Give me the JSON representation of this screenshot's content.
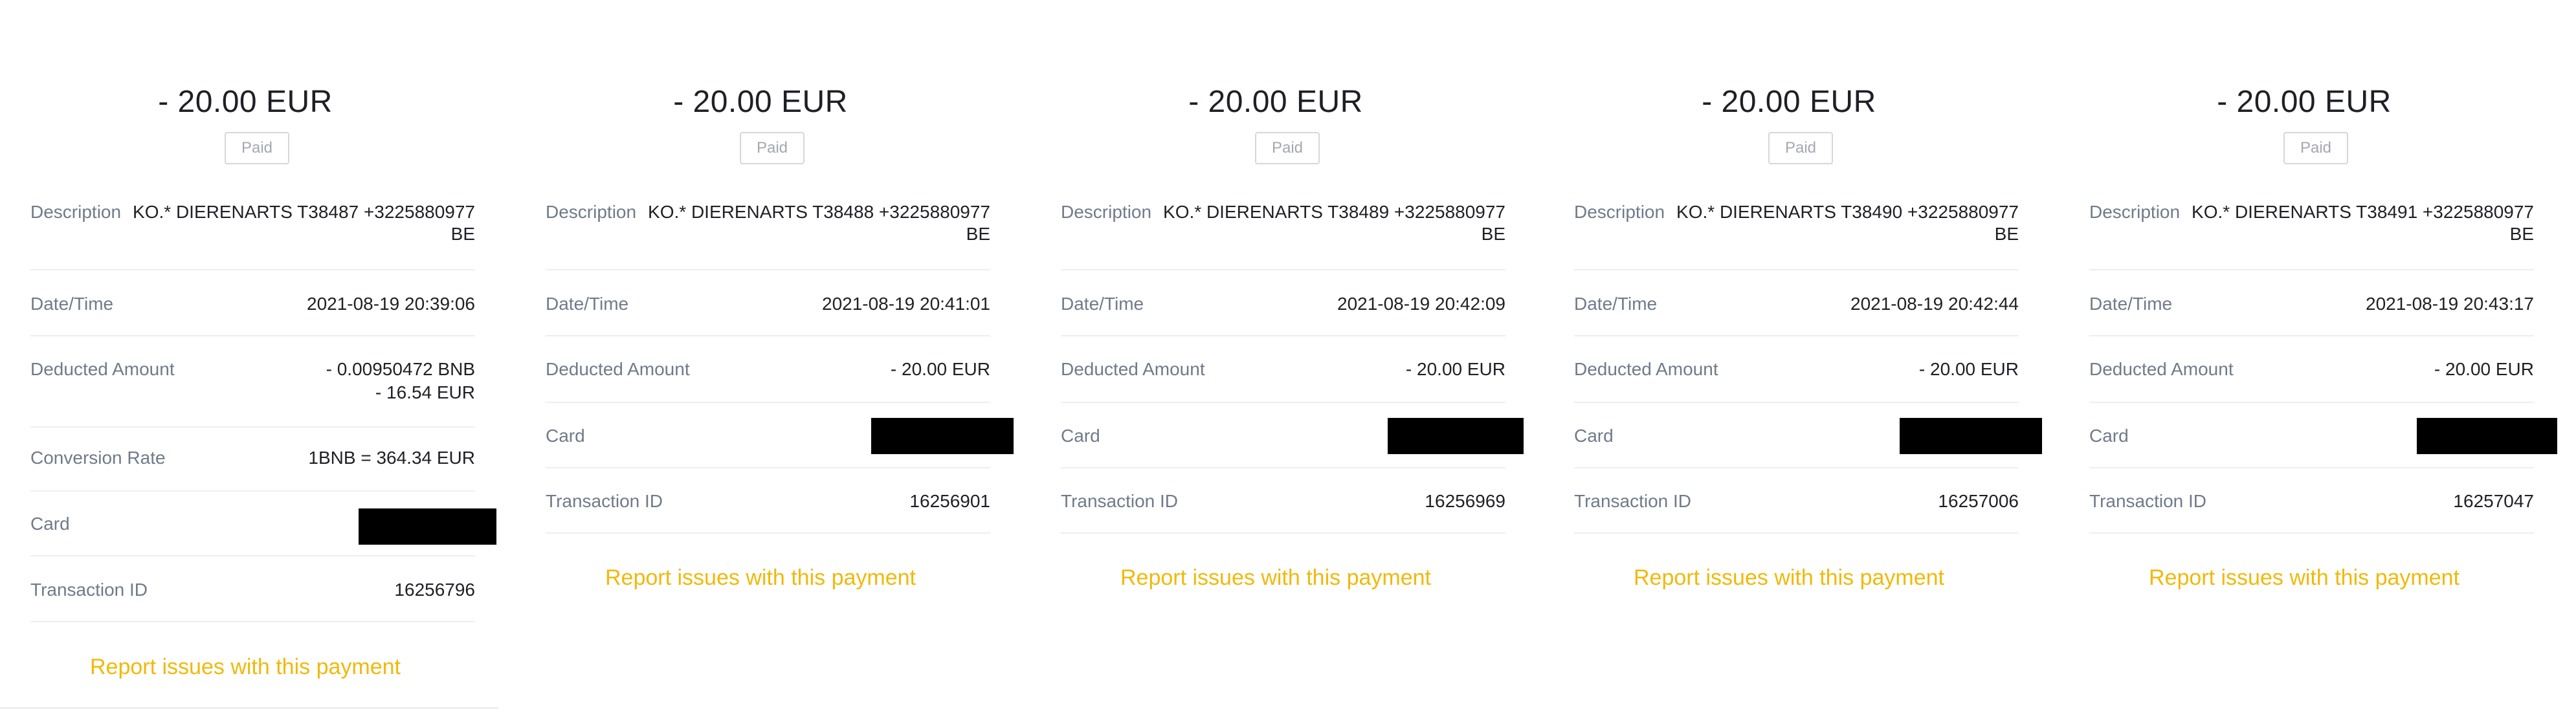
{
  "labels": {
    "status": "Paid",
    "description": "Description",
    "datetime": "Date/Time",
    "deducted": "Deducted Amount",
    "conversion": "Conversion Rate",
    "card": "Card",
    "txid": "Transaction ID",
    "report": "Report issues with this payment"
  },
  "panels": [
    {
      "amount": "- 20.00 EUR",
      "description_line1": "KO.* DIERENARTS T38487 +3225880977",
      "description_line2": "BE",
      "datetime": "2021-08-19 20:39:06",
      "deducted_line1": "- 0.00950472 BNB",
      "deducted_line2": "- 16.54 EUR",
      "conversion": "1BNB = 364.34 EUR",
      "txid": "16256796"
    },
    {
      "amount": "- 20.00 EUR",
      "description_line1": "KO.* DIERENARTS T38488 +3225880977",
      "description_line2": "BE",
      "datetime": "2021-08-19 20:41:01",
      "deducted_line1": "- 20.00 EUR",
      "txid": "16256901"
    },
    {
      "amount": "- 20.00 EUR",
      "description_line1": "KO.* DIERENARTS T38489 +3225880977",
      "description_line2": "BE",
      "datetime": "2021-08-19 20:42:09",
      "deducted_line1": "- 20.00 EUR",
      "txid": "16256969"
    },
    {
      "amount": "- 20.00 EUR",
      "description_line1": "KO.* DIERENARTS T38490 +3225880977",
      "description_line2": "BE",
      "datetime": "2021-08-19 20:42:44",
      "deducted_line1": "- 20.00 EUR",
      "txid": "16257006"
    },
    {
      "amount": "- 20.00 EUR",
      "description_line1": "KO.* DIERENARTS T38491 +3225880977",
      "description_line2": "BE",
      "datetime": "2021-08-19 20:43:17",
      "deducted_line1": "- 20.00 EUR",
      "txid": "16257047"
    }
  ],
  "colors": {
    "accent": "#f0b90b",
    "label": "#707a8a",
    "text": "#1e2026",
    "divider": "#eceef1",
    "redaction": "#000000"
  }
}
